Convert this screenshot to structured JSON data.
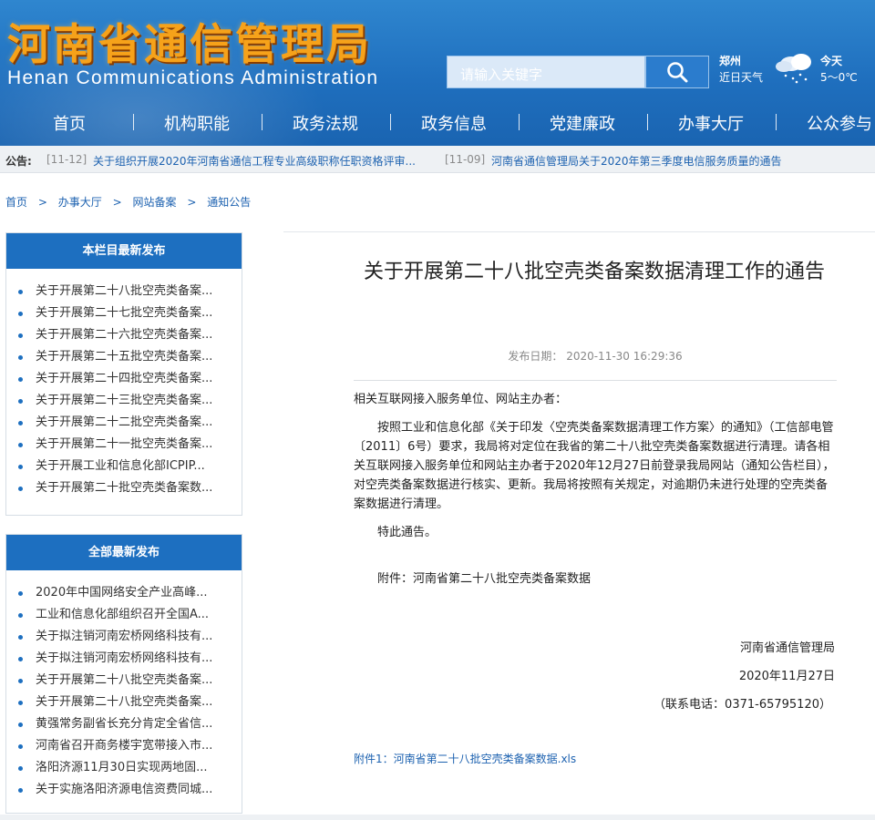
{
  "header": {
    "logo_cn": "河南省通信管理局",
    "logo_en": "Henan Communications Administration",
    "search_placeholder": "请输入关键字",
    "weather": {
      "city": "郑州",
      "label": "近日天气",
      "today": "今天",
      "temp": "5～0℃"
    },
    "colors": {
      "header_blue": "#1f6fbe",
      "logo_orange": "#f6a21a",
      "link_blue": "#1d62b0"
    }
  },
  "nav": {
    "items": [
      "首页",
      "机构职能",
      "政务法规",
      "政务信息",
      "党建廉政",
      "办事大厅",
      "公众参与"
    ]
  },
  "notice": {
    "label": "公告:",
    "items": [
      {
        "date": "[11-12]",
        "title": "关于组织开展2020年河南省通信工程专业高级职称任职资格评审..."
      },
      {
        "date": "[11-09]",
        "title": "河南省通信管理局关于2020年第三季度电信服务质量的通告"
      }
    ]
  },
  "breadcrumb": [
    "首页",
    "办事大厅",
    "网站备案",
    "通知公告"
  ],
  "breadcrumb_sep": ">",
  "sidebar": {
    "column_latest": {
      "title": "本栏目最新发布",
      "items": [
        "关于开展第二十八批空壳类备案...",
        "关于开展第二十七批空壳类备案...",
        "关于开展第二十六批空壳类备案...",
        "关于开展第二十五批空壳类备案...",
        "关于开展第二十四批空壳类备案...",
        "关于开展第二十三批空壳类备案...",
        "关于开展第二十二批空壳类备案...",
        "关于开展第二十一批空壳类备案...",
        "关于开展工业和信息化部ICPIP...",
        "关于开展第二十批空壳类备案数..."
      ]
    },
    "all_latest": {
      "title": "全部最新发布",
      "items": [
        "2020年中国网络安全产业高峰...",
        "工业和信息化部组织召开全国A...",
        "关于拟注销河南宏桥网络科技有...",
        "关于拟注销河南宏桥网络科技有...",
        "关于开展第二十八批空壳类备案...",
        "关于开展第二十八批空壳类备案...",
        "黄强常务副省长充分肯定全省信...",
        "河南省召开商务楼宇宽带接入市...",
        "洛阳济源11月30日实现两地固...",
        "关于实施洛阳济源电信资费同城..."
      ]
    }
  },
  "article": {
    "title": "关于开展第二十八批空壳类备案数据清理工作的通告",
    "date_label": "发布日期：",
    "date": "2020-11-30 16:29:36",
    "greeting": "相关互联网接入服务单位、网站主办者：",
    "body": "按照工业和信息化部《关于印发〈空壳类备案数据清理工作方案〉的通知》（工信部电管〔2011〕6号）要求，我局将对定位在我省的第二十八批空壳类备案数据进行清理。请各相关互联网接入服务单位和网站主办者于2020年12月27日前登录我局网站（通知公告栏目），对空壳类备案数据进行核实、更新。我局将按照有关规定，对逾期仍未进行处理的空壳类备案数据进行清理。",
    "closing": "特此通告。",
    "attachment_line": "附件：河南省第二十八批空壳类备案数据",
    "signature_org": "河南省通信管理局",
    "signature_date": "2020年11月27日",
    "contact": "（联系电话：0371-65795120）",
    "attachment_link": "附件1：河南省第二十八批空壳类备案数据.xls"
  }
}
